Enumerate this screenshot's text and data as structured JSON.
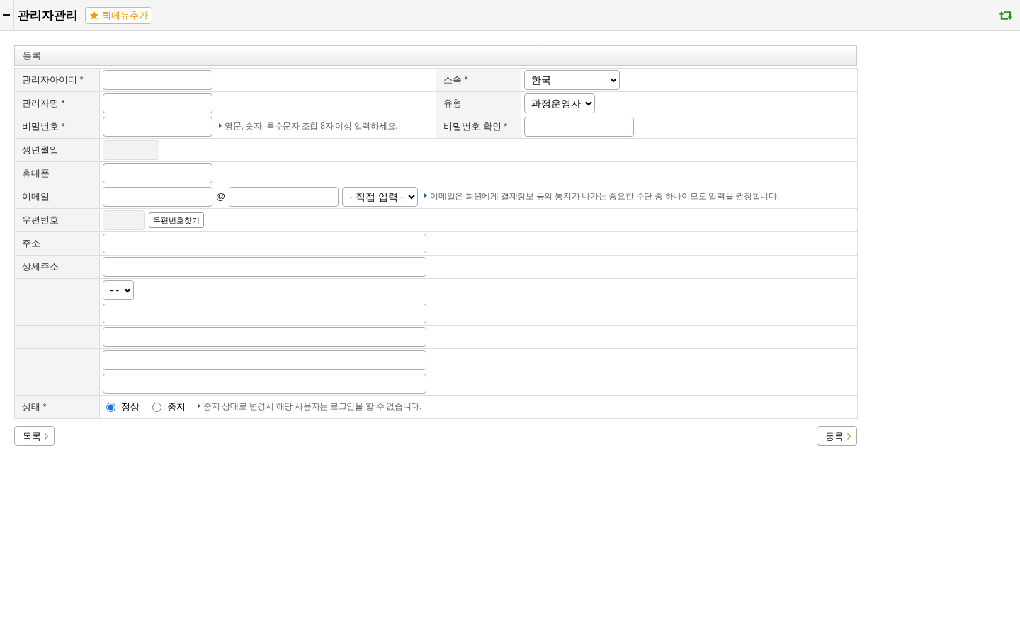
{
  "header": {
    "title": "관리자관리",
    "quick_menu_button": "퀵메뉴추가"
  },
  "form": {
    "title": "등록",
    "rows": [
      {
        "cells": [
          "관리자아이디 *",
          {
            "fields": [
              {
                "kind": "text",
                "disabled": false
              }
            ]
          },
          "소속 *",
          {
            "fields": [
              {
                "kind": "wide_select",
                "value": "한국"
              }
            ]
          }
        ]
      },
      {
        "cells": [
          "관리자명 *",
          {
            "fields": [
              {
                "kind": "text",
                "disabled": false
              }
            ]
          },
          "유형",
          {
            "fields": [
              {
                "kind": "select",
                "value": "과정운영자"
              }
            ]
          }
        ]
      },
      {
        "cells": [
          "비밀번호 *",
          {
            "fields": [
              {
                "kind": "text",
                "disabled": false
              },
              {
                "kind": "hint",
                "text": "영문, 숫자, 특수문자 조합 8자 이상 입력하세요."
              }
            ]
          },
          "비밀번호 확인 *",
          {
            "fields": [
              {
                "kind": "text",
                "disabled": false
              }
            ]
          }
        ]
      },
      {
        "cells": [
          "생년월일",
          {
            "colspan": 3,
            "fields": [
              {
                "kind": "date",
                "disabled": true
              }
            ]
          }
        ]
      },
      {
        "cells": [
          "휴대폰",
          {
            "colspan": 3,
            "fields": [
              {
                "kind": "text",
                "disabled": false
              }
            ]
          }
        ]
      },
      {
        "cells": [
          "이메일",
          {
            "colspan": 3,
            "fields": [
              {
                "kind": "text",
                "disabled": false
              },
              {
                "kind": "symbol",
                "text": "@"
              },
              {
                "kind": "text",
                "disabled": false
              },
              {
                "kind": "select",
                "value": "- 직접 입력 -"
              },
              {
                "kind": "hint",
                "text": "이메일은 회원에게 결제정보 등의 통지가 나가는 중요한 수단 중 하나이므로 입력을 권장합니다."
              }
            ]
          }
        ]
      },
      {
        "cells": [
          "우편번호",
          {
            "colspan": 3,
            "fields": [
              {
                "kind": "postcode",
                "disabled": true
              },
              {
                "kind": "button",
                "label": "우편번호찾기"
              }
            ]
          }
        ]
      },
      {
        "cells": [
          "주소",
          {
            "colspan": 3,
            "fields": [
              {
                "kind": "long_text",
                "disabled": false
              }
            ]
          }
        ]
      },
      {
        "cells": [
          "상세주소",
          {
            "colspan": 3,
            "fields": [
              {
                "kind": "long_text",
                "disabled": false
              }
            ]
          }
        ]
      },
      {
        "cells": [
          "",
          {
            "colspan": 3,
            "fields": [
              {
                "kind": "select",
                "value": "- -"
              }
            ]
          }
        ]
      },
      {
        "cells": [
          "",
          {
            "colspan": 3,
            "fields": [
              {
                "kind": "long_text",
                "disabled": false
              }
            ]
          }
        ]
      },
      {
        "cells": [
          "",
          {
            "colspan": 3,
            "fields": [
              {
                "kind": "long_text",
                "disabled": false
              }
            ]
          }
        ]
      },
      {
        "cells": [
          "",
          {
            "colspan": 3,
            "fields": [
              {
                "kind": "long_text",
                "disabled": false
              }
            ]
          }
        ]
      },
      {
        "cells": [
          "",
          {
            "colspan": 3,
            "fields": [
              {
                "kind": "long_text",
                "disabled": false
              }
            ]
          }
        ]
      },
      {
        "cells": [
          "상태 *",
          {
            "colspan": 3,
            "fields": [
              {
                "kind": "radio",
                "label": "정상",
                "selected": true
              },
              {
                "kind": "radio",
                "label": "중지",
                "selected": false
              },
              {
                "kind": "hint",
                "text": "중지 상태로 변경시 해당 사용자는 로그인을 할 수 없습니다."
              }
            ]
          }
        ]
      }
    ]
  },
  "actions": {
    "list_button": "목록",
    "submit_button": "등록"
  }
}
